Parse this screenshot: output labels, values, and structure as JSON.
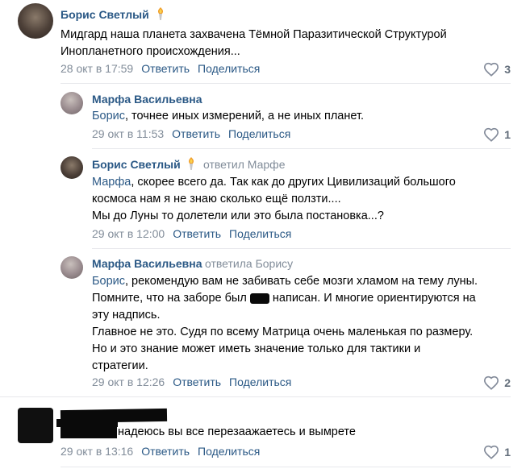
{
  "comments": [
    {
      "author": "Борис Светлый",
      "lines": [
        "Мидгард наша планета захвачена Тёмной Паразитической Структурой",
        "Инопланетного происхождения..."
      ],
      "date": "28 окт в 17:59",
      "reply": "Ответить",
      "share": "Поделиться",
      "likes": "3"
    },
    {
      "author": "Марфа Васильевна",
      "mention": "Борис",
      "line1_rest": ", точнее иных измерений, а не иных планет.",
      "date": "29 окт в 11:53",
      "reply": "Ответить",
      "share": "Поделиться",
      "likes": "1"
    },
    {
      "author": "Борис Светлый",
      "reply_to": "ответил Марфе",
      "mention": "Марфа",
      "line1_rest": ", скорее всего да. Так как до других Цивилизаций большого",
      "lines": [
        "космоса нам я не знаю сколько ещё ползти....",
        "Мы до Луны то долетели или это была постановка...?"
      ],
      "date": "29 окт в 12:00",
      "reply": "Ответить",
      "share": "Поделиться"
    },
    {
      "author": "Марфа Васильевна",
      "reply_to": "ответила Борису",
      "mention": "Борис",
      "line1_rest": ", рекомендую вам не забивать себе мозги хламом на тему луны.",
      "line2_before": "Помните, что на заборе был",
      "line2_after": "написан. И многие ориентируются на",
      "lines": [
        "эту надпись.",
        "Главное не это. Судя по всему Матрица очень маленькая по размеру.",
        "Но и это знание может иметь значение только для тактики и",
        "стратегии."
      ],
      "date": "29 окт в 12:26",
      "reply": "Ответить",
      "share": "Поделиться",
      "likes": "2"
    },
    {
      "text": "надеюсь вы все перезаажаетесь и вымрете",
      "date": "29 окт в 13:16",
      "reply": "Ответить",
      "share": "Поделиться",
      "likes": "1"
    }
  ],
  "colors": {
    "link": "#2a5885",
    "meta": "#818c99",
    "like": "#626d7a",
    "divider": "#e7e8ec"
  },
  "icons": [
    "heart-icon",
    "torch-icon"
  ]
}
